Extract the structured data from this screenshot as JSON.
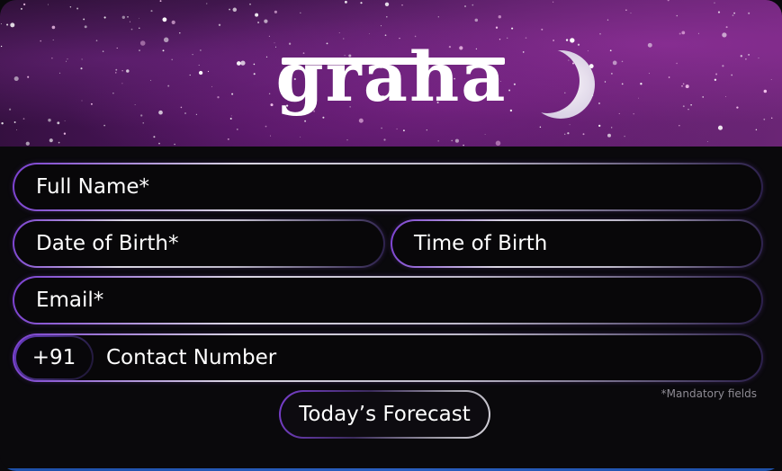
{
  "brand": {
    "logo_text": "graha"
  },
  "colors": {
    "background": "#0a090c",
    "accent": "#7a3fd0",
    "banner": "#4a1a58"
  },
  "icons": {
    "moon": "crescent-moon-icon"
  },
  "form": {
    "full_name_placeholder": "Full Name*",
    "dob_placeholder": "Date of Birth*",
    "tob_placeholder": "Time of Birth",
    "email_placeholder": "Email*",
    "country_code": "+91",
    "contact_placeholder": "Contact Number",
    "mandatory_note": "*Mandatory fields",
    "submit_label": "Today’s Forecast"
  }
}
